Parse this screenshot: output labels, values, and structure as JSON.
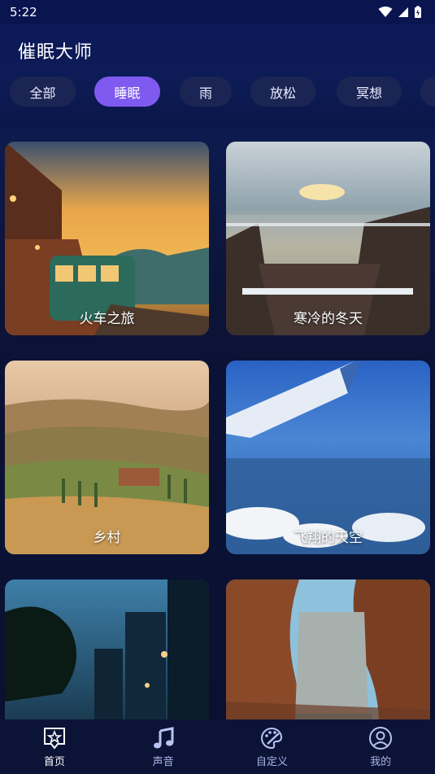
{
  "status": {
    "time": "5:22"
  },
  "app": {
    "title": "催眠大师"
  },
  "categories": [
    {
      "label": "全部",
      "active": false
    },
    {
      "label": "睡眠",
      "active": true
    },
    {
      "label": "雨",
      "active": false
    },
    {
      "label": "放松",
      "active": false
    },
    {
      "label": "冥想",
      "active": false
    }
  ],
  "cards": [
    {
      "label": "火车之旅",
      "scene": "train"
    },
    {
      "label": "寒冷的冬天",
      "scene": "winter"
    },
    {
      "label": "乡村",
      "scene": "countryside"
    },
    {
      "label": "飞翔的天空",
      "scene": "sky"
    },
    {
      "label": "",
      "scene": "city"
    },
    {
      "label": "",
      "scene": "canyon"
    }
  ],
  "nav": [
    {
      "label": "首页",
      "icon": "home-star-icon",
      "active": true
    },
    {
      "label": "声音",
      "icon": "music-note-icon",
      "active": false
    },
    {
      "label": "自定义",
      "icon": "palette-icon",
      "active": false
    },
    {
      "label": "我的",
      "icon": "profile-icon",
      "active": false
    }
  ],
  "colors": {
    "accent": "#7f5af0",
    "chip": "#1b2553",
    "background": "#0b1336"
  }
}
